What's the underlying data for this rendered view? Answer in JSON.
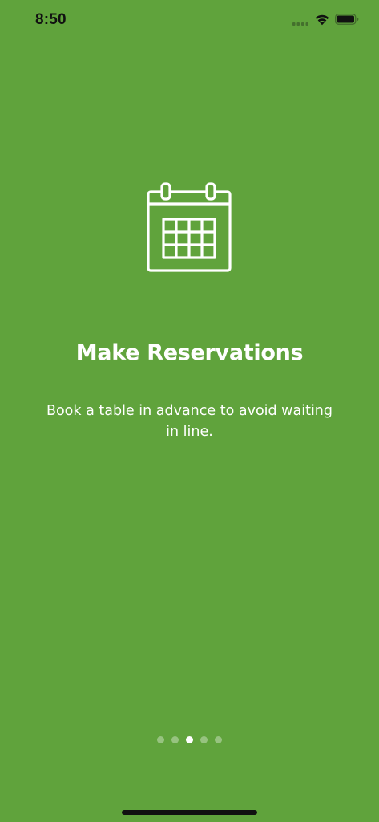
{
  "status_bar": {
    "time": "8:50",
    "icons": [
      "signal-icon",
      "wifi-icon",
      "battery-icon"
    ]
  },
  "colors": {
    "background": "#60a33c",
    "foreground": "#ffffff",
    "status_text": "#111111"
  },
  "onboarding": {
    "icon": "calendar-icon",
    "title": "Make Reservations",
    "description": "Book a table in advance to avoid waiting in line."
  },
  "page_indicator": {
    "total_pages": 5,
    "current_page": 3
  }
}
